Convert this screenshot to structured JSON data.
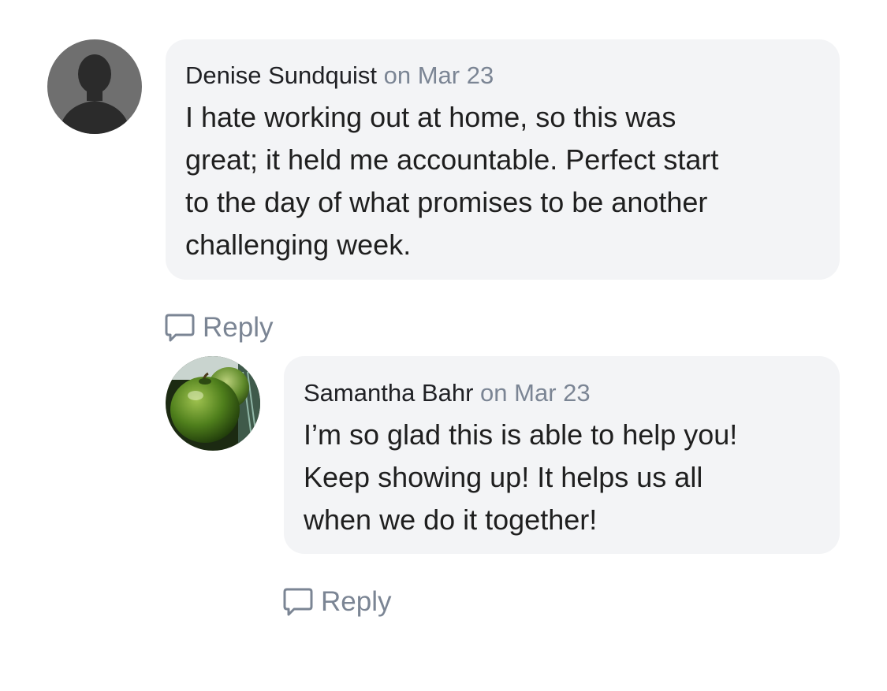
{
  "comments": [
    {
      "author": "Denise Sundquist",
      "date": "on Mar 23",
      "avatar_icon": "person-silhouette-icon",
      "text_lines": [
        "I hate working out at home, so this was",
        "great; it held me accountable. Perfect start",
        "to the day of what promises to be another",
        "challenging week."
      ],
      "reply_label": "Reply"
    },
    {
      "author": "Samantha Bahr",
      "date": "on Mar 23",
      "avatar_icon": "green-apple-photo-icon",
      "text_lines": [
        "I’m so glad this is able to help you!",
        "Keep showing up! It helps us all",
        "when we do it together!"
      ],
      "reply_label": "Reply"
    }
  ],
  "colors": {
    "bubble_bg": "#f3f4f6",
    "meta_gray": "#7b8594",
    "text": "#1f1f1f"
  }
}
